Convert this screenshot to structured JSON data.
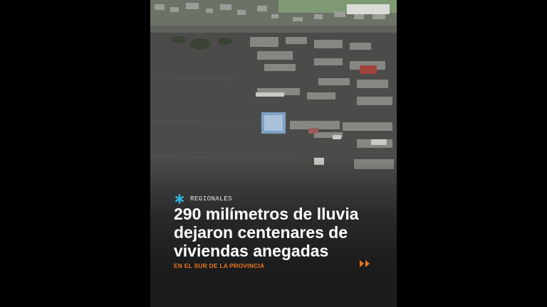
{
  "post": {
    "section_label": "REGIONALES",
    "headline_lines": [
      "290 milímetros de lluvia",
      "dejaron centenares de",
      "viviendas anegadas"
    ],
    "subline": "EN EL SUR DE LA PROVINCIA"
  },
  "colors": {
    "accent_orange": "#e8761e",
    "accent_blue": "#2fb6e8",
    "overlay_dark": "#1c1c1c",
    "flood_water": "#4c4d4b"
  },
  "icons": {
    "section_icon": "asterisk-icon",
    "next_icon": "double-chevron-right-icon"
  },
  "image": {
    "subject": "aerial view of flooded town"
  }
}
